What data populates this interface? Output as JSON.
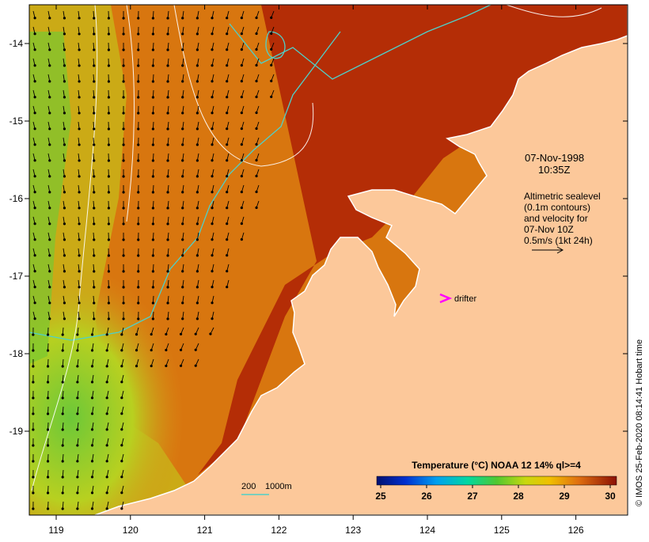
{
  "map": {
    "date_line": "07-Nov-1998",
    "time_line": "10:35Z",
    "info_lines": [
      "Altimetric sealevel",
      "(0.1m contours)",
      "and velocity for",
      "07-Nov 10Z",
      "0.5m/s (1kt 24h)"
    ],
    "drifter_label": "drifter",
    "depth_legend": {
      "label1": "200",
      "label2": "1000m"
    },
    "credit": "© IMOS 25-Feb-2020 08:14:41 Hobart time",
    "x_ticks": [
      "119",
      "120",
      "121",
      "122",
      "123",
      "124",
      "125",
      "126"
    ],
    "y_ticks": [
      "-14",
      "-15",
      "-16",
      "-17",
      "-18",
      "-19"
    ],
    "colorbar": {
      "title": "Temperature (°C) NOAA 12 14% ql>=4",
      "tick_labels": [
        "25",
        "26",
        "27",
        "28",
        "29",
        "30"
      ],
      "min": 25,
      "max": 30
    },
    "colors": {
      "land": "#fcc89a",
      "ocean_warm": "#b42d06",
      "ocean_mid": "#d8760f",
      "ocean_cool": "#9fcf2b",
      "contour": "#4fd0c8",
      "drifter": "#ff00ff"
    }
  }
}
